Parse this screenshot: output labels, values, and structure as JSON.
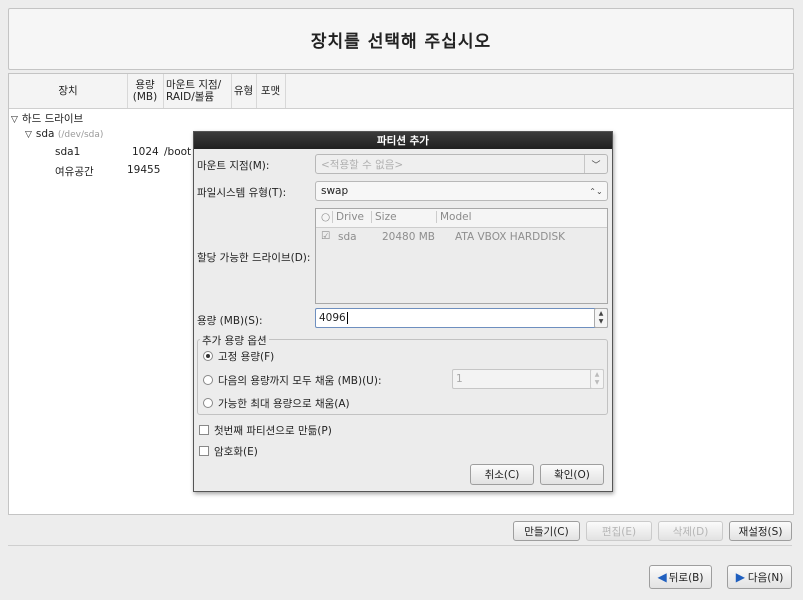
{
  "header": {
    "title": "장치를 선택해 주십시오"
  },
  "columns": {
    "device": "장치",
    "size_line1": "용량",
    "size_line2": "(MB)",
    "mount_line1": "마운트 지점/",
    "mount_line2": "RAID/볼륨",
    "type": "유형",
    "format": "포맷"
  },
  "tree": {
    "hard_drives": "하드 드라이브",
    "sda_name": "sda",
    "sda_path": "(/dev/sda)",
    "sda1_name": "sda1",
    "sda1_size": "1024",
    "sda1_mount": "/boot",
    "free_name": "여유공간",
    "free_size": "19455"
  },
  "actions": {
    "create": "만들기(C)",
    "edit": "편집(E)",
    "delete": "삭제(D)",
    "reset": "재설정(S)"
  },
  "nav": {
    "back": "뒤로(B)",
    "next": "다음(N)"
  },
  "dialog": {
    "title": "파티션 추가",
    "mount_label": "마운트 지점(M):",
    "mount_placeholder": "<적용할 수 없음>",
    "fstype_label": "파일시스템 유형(T):",
    "fstype_value": "swap",
    "drives_label": "할당 가능한 드라이브(D):",
    "drives_header": {
      "radio": "○",
      "drive": "Drive",
      "size": "Size",
      "model": "Model"
    },
    "drives": [
      {
        "checked": true,
        "drive": "sda",
        "size": "20480 MB",
        "model": "ATA VBOX HARDDISK"
      }
    ],
    "size_label": "용량 (MB)(S):",
    "size_value": "4096",
    "options_title": "추가 용량 옵션",
    "opt_fixed": "고정 용량(F)",
    "opt_fill_upto": "다음의 용량까지 모두 채움 (MB)(U):",
    "opt_fill_upto_value": "1",
    "opt_fill_max": "가능한 최대 용량으로 채움(A)",
    "primary_label": "첫번째 파티션으로 만듦(P)",
    "encrypt_label": "암호화(E)",
    "cancel": "취소(C)",
    "ok": "확인(O)"
  }
}
